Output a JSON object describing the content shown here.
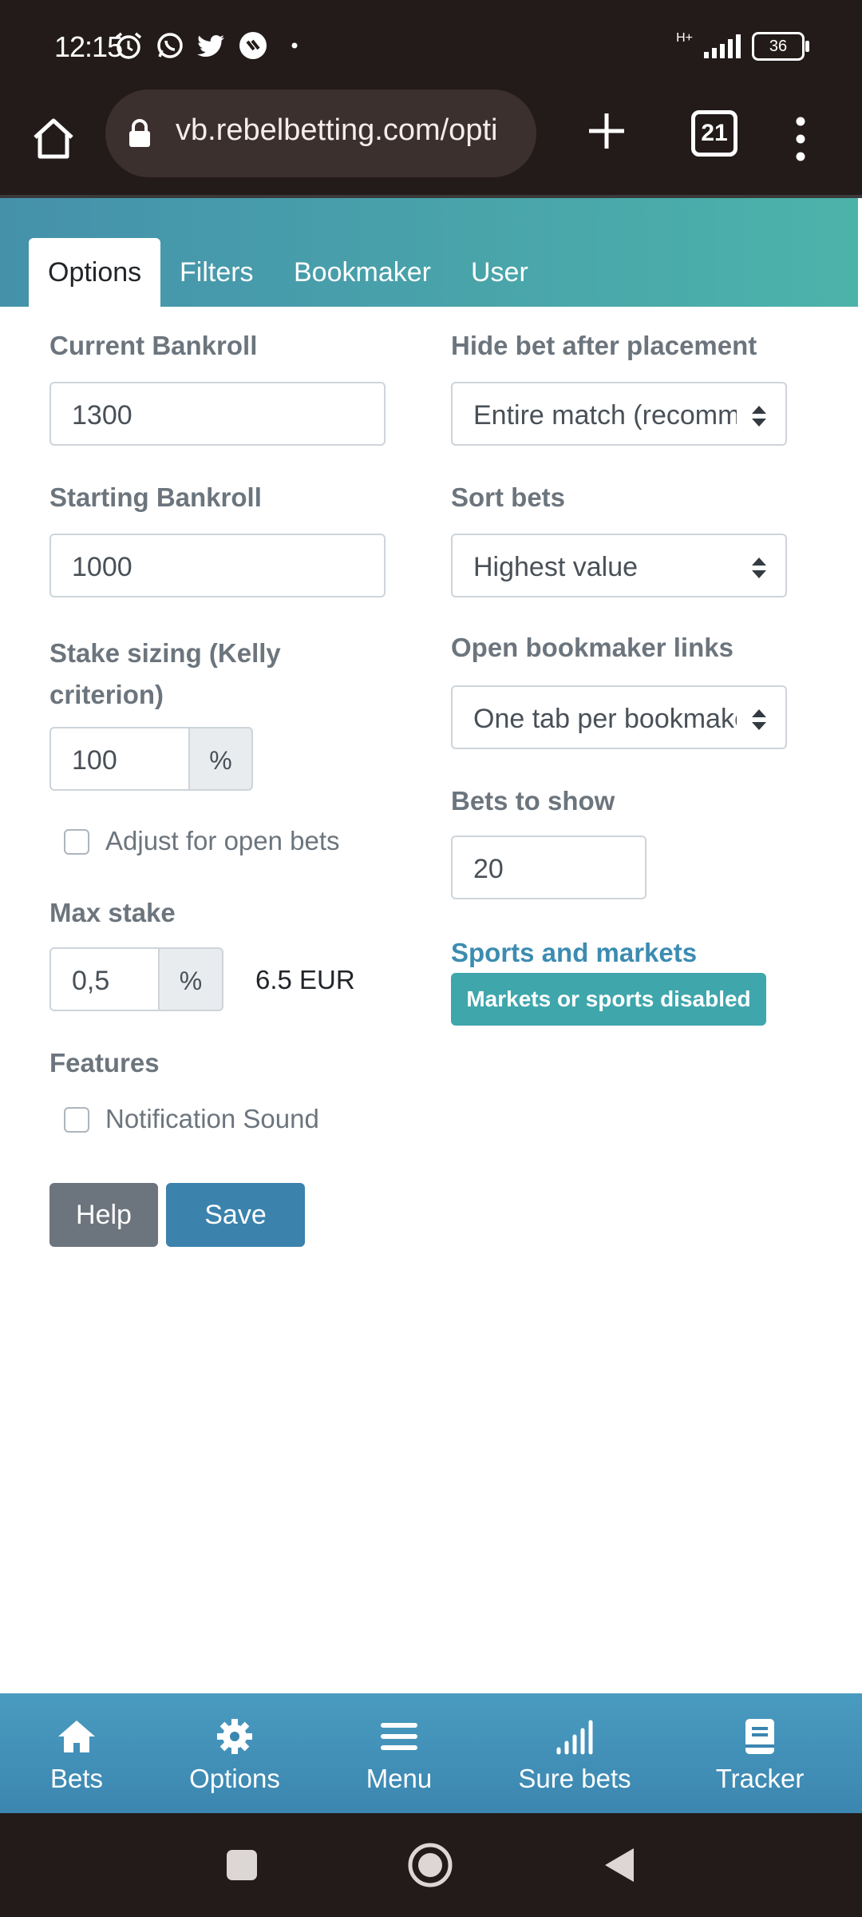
{
  "status_bar": {
    "time": "12:15",
    "network": "H+",
    "battery": "36"
  },
  "browser": {
    "url": "vb.rebelbetting.com/opti",
    "tab_count": "21"
  },
  "tabs": [
    {
      "label": "Options",
      "active": true
    },
    {
      "label": "Filters",
      "active": false
    },
    {
      "label": "Bookmaker",
      "active": false
    },
    {
      "label": "User",
      "active": false
    }
  ],
  "form": {
    "current_bankroll": {
      "label": "Current Bankroll",
      "value": "1300"
    },
    "starting_bankroll": {
      "label": "Starting Bankroll",
      "value": "1000"
    },
    "stake_sizing": {
      "label": "Stake sizing (Kelly criterion)",
      "value": "100",
      "unit": "%"
    },
    "adjust_open_bets": {
      "label": "Adjust for open bets",
      "checked": false
    },
    "max_stake": {
      "label": "Max stake",
      "value": "0,5",
      "unit": "%",
      "computed": "6.5 EUR"
    },
    "features": {
      "label": "Features"
    },
    "notification_sound": {
      "label": "Notification Sound",
      "checked": false
    },
    "hide_bet": {
      "label": "Hide bet after placement",
      "value": "Entire match (recommended)"
    },
    "sort_bets": {
      "label": "Sort bets",
      "value": "Highest value"
    },
    "open_links": {
      "label": "Open bookmaker links",
      "value": "One tab per bookmaker"
    },
    "bets_to_show": {
      "label": "Bets to show",
      "value": "20"
    },
    "sports_markets": {
      "label": "Sports and markets",
      "badge": "Markets or sports disabled"
    },
    "help_label": "Help",
    "save_label": "Save"
  },
  "bottom_nav": [
    {
      "label": "Bets",
      "icon": "home-icon"
    },
    {
      "label": "Options",
      "icon": "gear-icon"
    },
    {
      "label": "Menu",
      "icon": "menu-icon"
    },
    {
      "label": "Sure bets",
      "icon": "signal-bars-icon"
    },
    {
      "label": "Tracker",
      "icon": "book-icon"
    }
  ],
  "colors": {
    "header_gradient_start": "#4591ab",
    "header_gradient_end": "#4cb3aa",
    "save_button": "#3b82ad",
    "help_button": "#6c757d",
    "badge": "#3fa6ac",
    "bottom_nav": "#3b86b0"
  }
}
